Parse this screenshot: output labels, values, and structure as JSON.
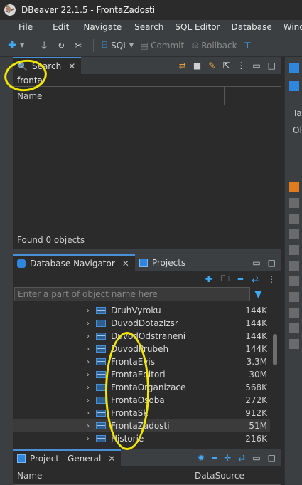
{
  "window": {
    "title": "DBeaver 22.1.5 - FrontaZadosti"
  },
  "menu": [
    "File",
    "Edit",
    "Navigate",
    "Search",
    "SQL Editor",
    "Database",
    "Window"
  ],
  "toolbar": {
    "sql_label": "SQL",
    "commit_label": "Commit",
    "rollback_label": "Rollback"
  },
  "search_panel": {
    "tab_label": "Search",
    "query": "fronta",
    "column_name": "Name",
    "found_text": "Found 0 objects"
  },
  "navigator": {
    "tab_label": "Database Navigator",
    "projects_tab": "Projects",
    "filter_placeholder": "Enter a part of object name here",
    "rows": [
      {
        "name": "DruhVyroku",
        "size": "144K"
      },
      {
        "name": "DuvodDotazIzsr",
        "size": "144K"
      },
      {
        "name": "DuvodOdstraneni",
        "size": "144K"
      },
      {
        "name": "DuvodPrubeh",
        "size": "144K"
      },
      {
        "name": "FrontaEvis",
        "size": "3.3M"
      },
      {
        "name": "FrontaEditori",
        "size": "30M"
      },
      {
        "name": "FrontaOrganizace",
        "size": "568K"
      },
      {
        "name": "FrontaOsoba",
        "size": "272K"
      },
      {
        "name": "FrontaSk",
        "size": "912K"
      },
      {
        "name": "FrontaZadosti",
        "size": "51M"
      },
      {
        "name": "Historie",
        "size": "216K"
      }
    ]
  },
  "project_panel": {
    "tab_label": "Project - General",
    "col_name": "Name",
    "col_datasource": "DataSource"
  },
  "right_panel": {
    "text1": "Ta",
    "text2": "Ol"
  },
  "colors": {
    "accent": "#4a90d9",
    "annotation": "#f2e600"
  }
}
